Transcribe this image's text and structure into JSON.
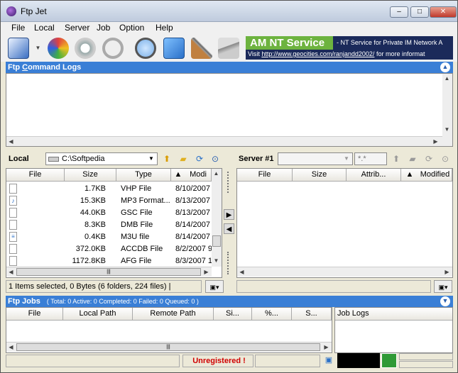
{
  "window": {
    "title": "Ftp Jet",
    "minimize": "–",
    "maximize": "□",
    "close": "✕"
  },
  "menu": [
    "File",
    "Local",
    "Server",
    "Job",
    "Option",
    "Help"
  ],
  "banner": {
    "title": "AM NT Service",
    "subtitle": "- NT Service for Private IM Network A",
    "link_prefix": "Visit ",
    "link": "http://www.geocities.com/ranjandd2002/",
    "link_suffix": " for more informat"
  },
  "command_logs": {
    "title_prefix": "Ftp ",
    "title_underlined": "C",
    "title_suffix": "ommand Logs"
  },
  "local": {
    "label": "Local",
    "path": "C:\\Softpedia",
    "columns": [
      "File",
      "Size",
      "Type",
      "Modi"
    ],
    "sort_icon": "▲",
    "rows": [
      {
        "icon": "file-icon",
        "name": "",
        "size": "1.7KB",
        "type": "VHP File",
        "modified": "8/10/2007"
      },
      {
        "icon": "music-file-icon",
        "name": "",
        "size": "15.3KB",
        "type": "MP3 Format...",
        "modified": "8/13/2007"
      },
      {
        "icon": "file-icon",
        "name": "",
        "size": "44.0KB",
        "type": "GSC File",
        "modified": "8/13/2007"
      },
      {
        "icon": "file-icon",
        "name": "",
        "size": "8.3KB",
        "type": "DMB File",
        "modified": "8/14/2007"
      },
      {
        "icon": "playlist-file-icon",
        "name": "",
        "size": "0.4KB",
        "type": "M3U file",
        "modified": "8/14/2007"
      },
      {
        "icon": "file-icon",
        "name": "",
        "size": "372.0KB",
        "type": "ACCDB File",
        "modified": "8/2/2007 9"
      },
      {
        "icon": "file-icon",
        "name": "",
        "size": "1172.8KB",
        "type": "AFG File",
        "modified": "8/3/2007 1"
      }
    ],
    "status": "1 Items selected, 0 Bytes (6 folders, 224 files)  |"
  },
  "server": {
    "label": "Server #1",
    "path": "",
    "filter": "*.*",
    "columns": [
      "File",
      "Size",
      "Attrib...",
      "Modified"
    ],
    "sort_icon": "▲"
  },
  "jobs": {
    "title": "Ftp Jobs",
    "summary": "( Total: 0     Active: 0     Completed: 0     Failed: 0     Queued: 0 )",
    "columns": [
      "File",
      "Local Path",
      "Remote Path",
      "Si...",
      "%...",
      "S..."
    ],
    "job_logs": "Job Logs"
  },
  "footer": {
    "unregistered": "Unregistered !"
  },
  "colors": {
    "accent": "#3a7fd6",
    "banner_bg": "#1b2a5a",
    "banner_green": "#6db33f",
    "warning": "#d00000"
  }
}
